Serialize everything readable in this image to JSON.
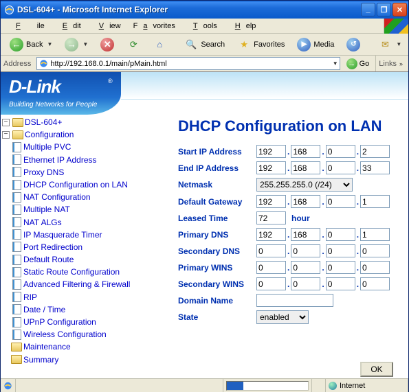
{
  "window": {
    "title": "DSL-604+ - Microsoft Internet Explorer"
  },
  "menu": {
    "file": "File",
    "edit": "Edit",
    "view": "View",
    "favorites": "Favorites",
    "tools": "Tools",
    "help": "Help"
  },
  "toolbar": {
    "back": "Back",
    "search": "Search",
    "favorites": "Favorites",
    "media": "Media"
  },
  "address": {
    "label": "Address",
    "url": "http://192.168.0.1/main/pMain.html",
    "go": "Go",
    "links": "Links"
  },
  "brand": {
    "logo": "D-Link",
    "tagline": "Building Networks for People"
  },
  "tree": {
    "root": "DSL-604+",
    "config": "Configuration",
    "items": [
      "Multiple PVC",
      "Ethernet IP Address",
      "Proxy DNS",
      "DHCP Configuration on LAN",
      "NAT Configuration",
      "Multiple NAT",
      "NAT ALGs",
      "IP Masquerade Timer",
      "Port Redirection",
      "Default Route",
      "Static Route Configuration",
      "Advanced Filtering & Firewall",
      "RIP",
      "Date / Time",
      "UPnP Configuration",
      "Wireless Configuration"
    ],
    "maintenance": "Maintenance",
    "summary": "Summary"
  },
  "page": {
    "title": "DHCP Configuration on LAN",
    "labels": {
      "start_ip": "Start IP Address",
      "end_ip": "End IP Address",
      "netmask": "Netmask",
      "gateway": "Default Gateway",
      "leased": "Leased Time",
      "leased_unit": "hour",
      "pdns": "Primary DNS",
      "sdns": "Secondary DNS",
      "pwins": "Primary WINS",
      "swins": "Secondary WINS",
      "domain": "Domain Name",
      "state": "State"
    },
    "start_ip": [
      "192",
      "168",
      "0",
      "2"
    ],
    "end_ip": [
      "192",
      "168",
      "0",
      "33"
    ],
    "netmask": "255.255.255.0 (/24)",
    "gateway": [
      "192",
      "168",
      "0",
      "1"
    ],
    "leased": "72",
    "pdns": [
      "192",
      "168",
      "0",
      "1"
    ],
    "sdns": [
      "0",
      "0",
      "0",
      "0"
    ],
    "pwins": [
      "0",
      "0",
      "0",
      "0"
    ],
    "swins": [
      "0",
      "0",
      "0",
      "0"
    ],
    "domain": "",
    "state": "enabled",
    "ok": "OK"
  },
  "status": {
    "zone": "Internet"
  }
}
